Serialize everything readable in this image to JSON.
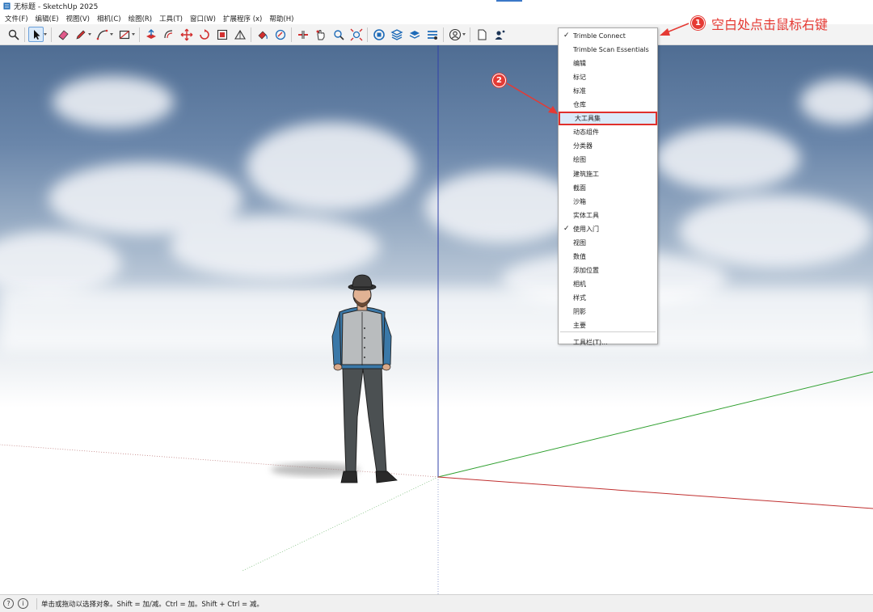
{
  "window": {
    "title": "无标题 - SketchUp 2025"
  },
  "menubar": [
    "文件(F)",
    "编辑(E)",
    "视图(V)",
    "相机(C)",
    "绘图(R)",
    "工具(T)",
    "窗口(W)",
    "扩展程序 (x)",
    "帮助(H)"
  ],
  "toolbar": {
    "icons": [
      "search-icon",
      "select-icon",
      "eraser-icon",
      "pencil-icon",
      "arc-icon",
      "rectangle-icon",
      "push-pull-icon",
      "offset-icon",
      "move-icon",
      "rotate-icon",
      "scale-icon",
      "tape-icon",
      "paint-icon",
      "section-icon",
      "orbit-icon",
      "pan-icon",
      "zoom-icon",
      "zoom-extents-icon",
      "warehouse-icon",
      "extension-icon",
      "layers-icon",
      "styles-icon",
      "account-icon",
      "new-file-icon",
      "profile-icon"
    ]
  },
  "context_menu": {
    "items": [
      {
        "label": "Trimble Connect",
        "checked": true
      },
      {
        "label": "Trimble Scan Essentials",
        "checked": false
      },
      {
        "label": "编辑",
        "checked": false
      },
      {
        "label": "标记",
        "checked": false
      },
      {
        "label": "标准",
        "checked": false
      },
      {
        "label": "仓库",
        "checked": false
      },
      {
        "label": "大工具集",
        "checked": false
      },
      {
        "label": "动态组件",
        "checked": false
      },
      {
        "label": "分类器",
        "checked": false
      },
      {
        "label": "绘图",
        "checked": false
      },
      {
        "label": "建筑施工",
        "checked": false
      },
      {
        "label": "截面",
        "checked": false
      },
      {
        "label": "沙箱",
        "checked": false
      },
      {
        "label": "实体工具",
        "checked": false
      },
      {
        "label": "使用入门",
        "checked": true
      },
      {
        "label": "视图",
        "checked": false
      },
      {
        "label": "数值",
        "checked": false
      },
      {
        "label": "添加位置",
        "checked": false
      },
      {
        "label": "相机",
        "checked": false
      },
      {
        "label": "样式",
        "checked": false
      },
      {
        "label": "阴影",
        "checked": false
      },
      {
        "label": "主要",
        "checked": false
      },
      {
        "label": "工具栏(T)...",
        "checked": false
      }
    ],
    "highlighted": "大工具集",
    "check_mark": "✓"
  },
  "annotations": {
    "step1_number": "1",
    "step1_text": "空白处点击鼠标右键",
    "step2_number": "2",
    "color": "#e53a34"
  },
  "statusbar": {
    "text": "单击或拖动以选择对象。Shift = 加/减。Ctrl = 加。Shift + Ctrl = 减。"
  },
  "colors": {
    "axis_blue": "#3040a8",
    "axis_red": "#c03030",
    "axis_green": "#30a030",
    "highlight_bg": "#dbeaf9"
  }
}
